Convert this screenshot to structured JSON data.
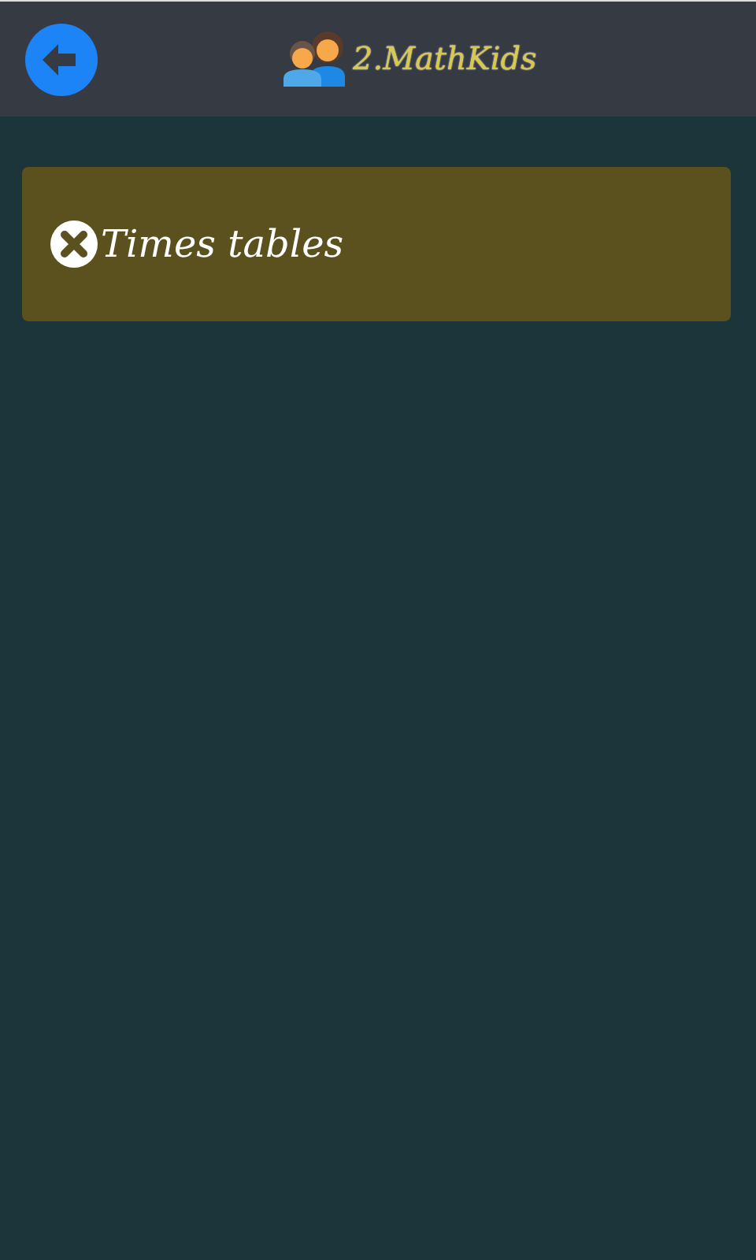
{
  "header": {
    "title": "2.MathKids"
  },
  "card": {
    "title": "Times tables"
  }
}
